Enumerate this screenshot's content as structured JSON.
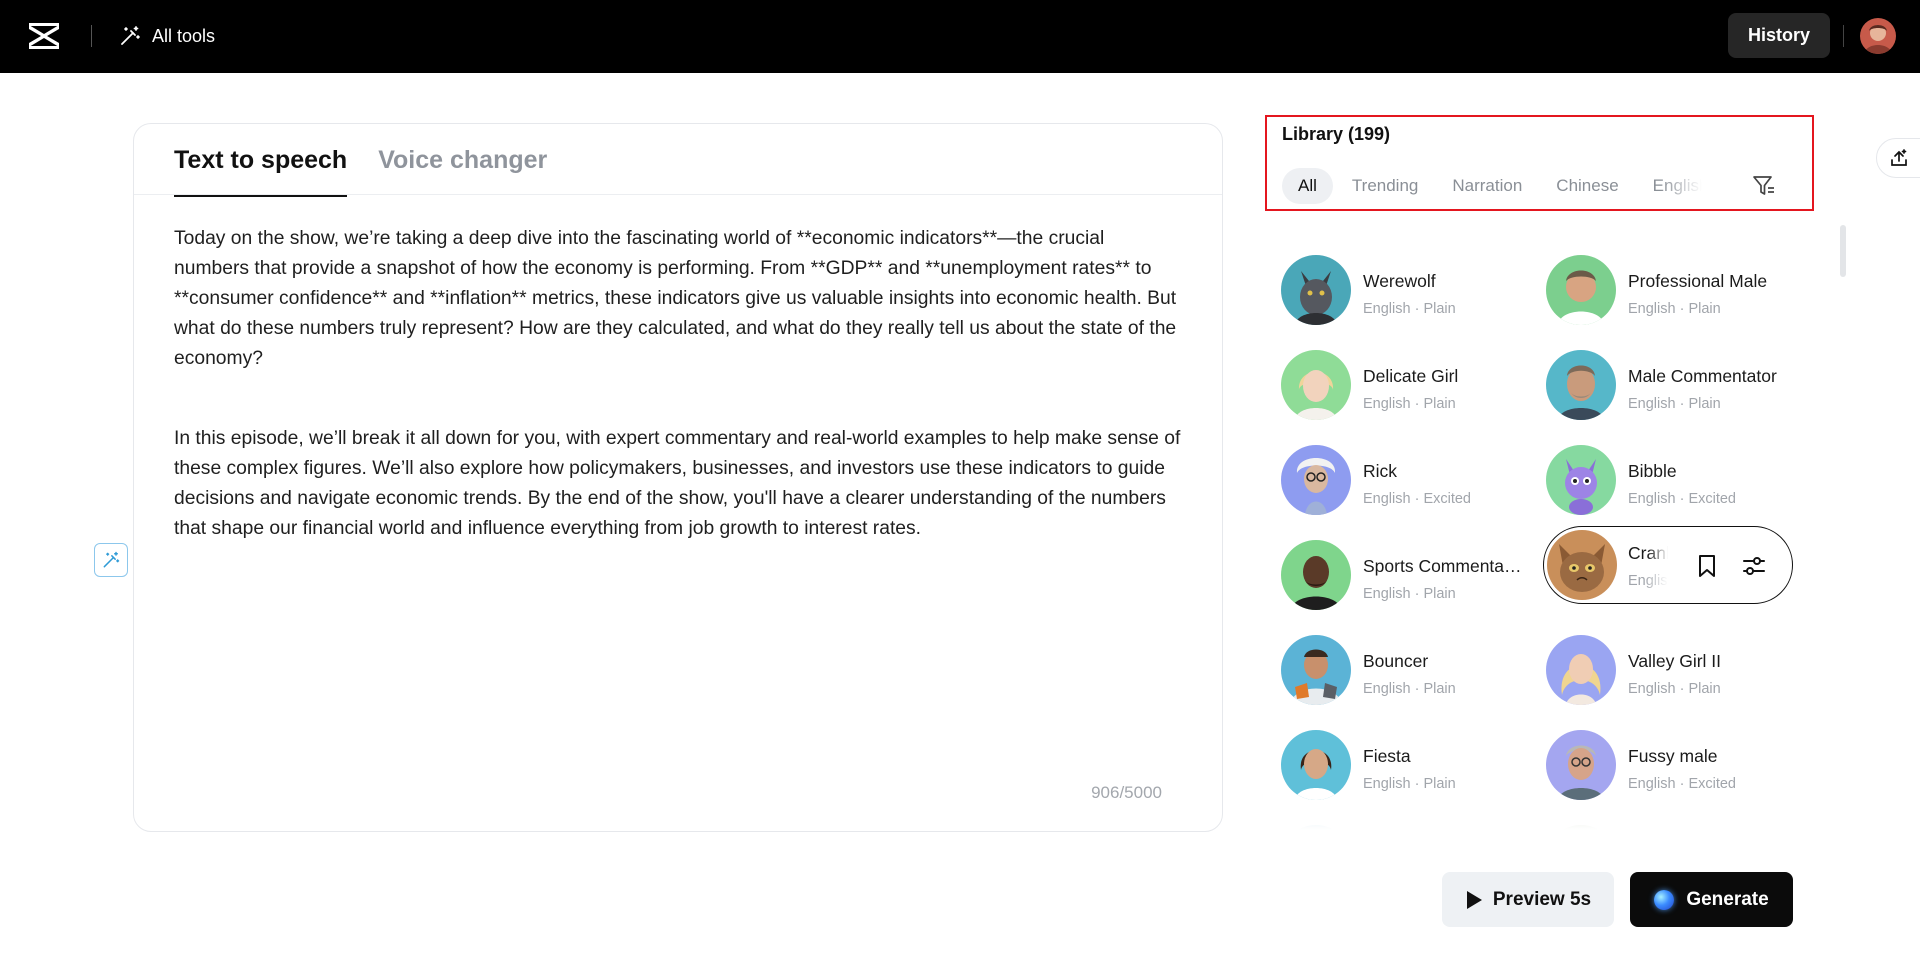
{
  "topbar": {
    "all_tools_label": "All tools",
    "history_label": "History"
  },
  "editor": {
    "tabs": [
      {
        "label": "Text to speech",
        "active": true
      },
      {
        "label": "Voice changer",
        "active": false
      }
    ],
    "paragraphs": [
      "Today on the show, we’re taking a deep dive into the fascinating world of **economic indicators**—the crucial numbers that provide a snapshot of how the economy is performing. From **GDP** and **unemployment rates** to **consumer confidence** and **inflation** metrics, these indicators give us valuable insights into economic health. But what do these numbers truly represent? How are they calculated, and what do they really tell us about the state of the economy?",
      "In this episode, we’ll break it all down for you, with expert commentary and real-world examples to help make sense of these complex figures. We’ll also explore how policymakers, businesses, and investors use these indicators to guide decisions and navigate economic trends. By the end of the show, you'll have a clearer understanding of the numbers that shape our financial world and influence everything from job growth to interest rates."
    ],
    "char_count": "906/5000"
  },
  "library": {
    "title": "Library (199)",
    "filters": [
      "All",
      "Trending",
      "Narration",
      "Chinese",
      "English"
    ],
    "active_filter": "All",
    "voices": [
      {
        "name": "Werewolf",
        "meta": "English · Plain",
        "color": "#4aa7b8"
      },
      {
        "name": "Professional Male",
        "meta": "English · Plain",
        "color": "#7ccf8e"
      },
      {
        "name": "Delicate Girl",
        "meta": "English · Plain",
        "color": "#8fdc97"
      },
      {
        "name": "Male Commentator",
        "meta": "English · Plain",
        "color": "#56b7c9"
      },
      {
        "name": "Rick",
        "meta": "English · Excited",
        "color": "#8e9cf0"
      },
      {
        "name": "Bibble",
        "meta": "English · Excited",
        "color": "#86d9a0"
      },
      {
        "name": "Sports Commentator",
        "meta": "English · Plain",
        "color": "#7fd58c"
      },
      {
        "name": "Cranky Cat",
        "meta": "English · Plain",
        "color": "#c98f5a"
      },
      {
        "name": "Bouncer",
        "meta": "English · Plain",
        "color": "#5bb3d6"
      },
      {
        "name": "Valley Girl II",
        "meta": "English · Plain",
        "color": "#9aa5f2"
      },
      {
        "name": "Fiesta",
        "meta": "English · Plain",
        "color": "#5fc0d9"
      },
      {
        "name": "Fussy male",
        "meta": "English · Excited",
        "color": "#a4a6f0"
      }
    ]
  },
  "actions": {
    "preview_label": "Preview 5s",
    "generate_label": "Generate"
  },
  "colors": {
    "accent_highlight": "#e4161f",
    "topbar": "#000000",
    "generate_bg": "#0b0b0b",
    "preview_bg": "#eef1f4"
  },
  "icons": [
    "capcut-logo-icon",
    "magic-wand-icon",
    "user-avatar",
    "filter-icon",
    "upload-icon",
    "bookmark-icon",
    "adjust-sliders-icon",
    "play-icon",
    "generate-orb-icon"
  ]
}
